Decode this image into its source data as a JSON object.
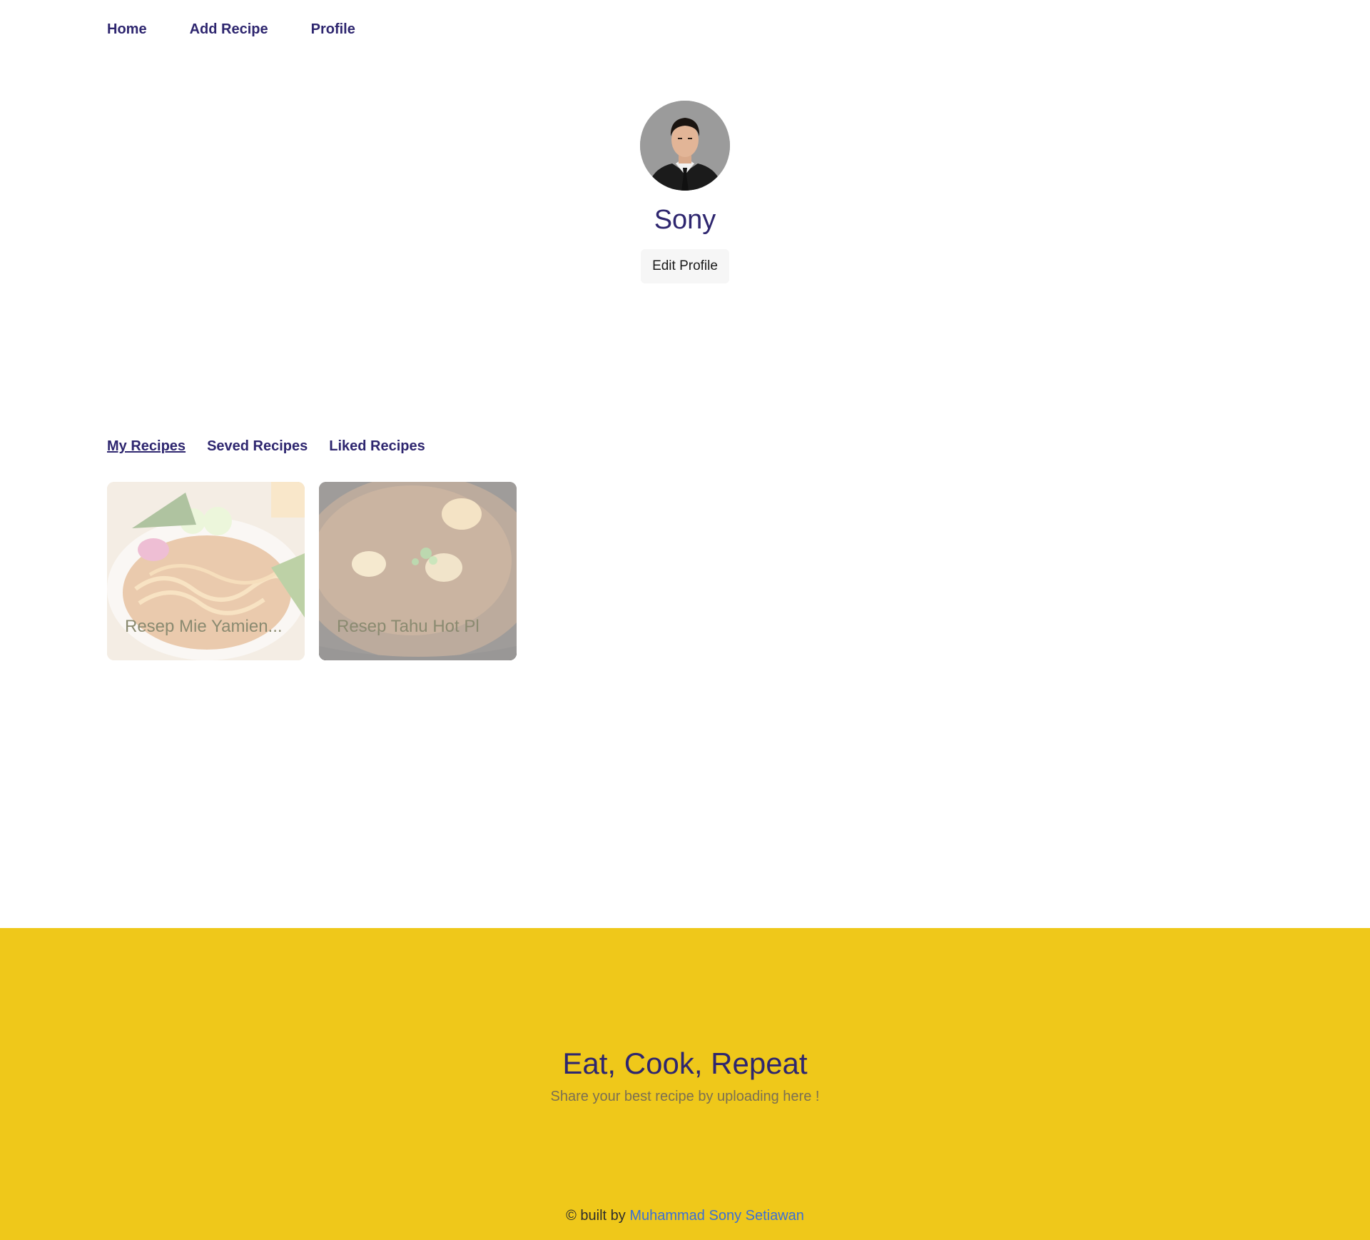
{
  "nav": {
    "items": [
      {
        "label": "Home"
      },
      {
        "label": "Add Recipe"
      },
      {
        "label": "Profile"
      }
    ]
  },
  "profile": {
    "name": "Sony",
    "edit_label": "Edit Profile"
  },
  "tabs": [
    {
      "label": "My Recipes",
      "active": true
    },
    {
      "label": "Seved Recipes",
      "active": false
    },
    {
      "label": "Liked Recipes",
      "active": false
    }
  ],
  "recipes": [
    {
      "title": "Resep Mie Yamien..."
    },
    {
      "title": "Resep Tahu Hot Pl"
    }
  ],
  "footer": {
    "title": "Eat, Cook, Repeat",
    "subtitle": "Share your best recipe by uploading here !",
    "credit_prefix": "© built by",
    "credit_name": "Muhammad Sony Setiawan"
  },
  "colors": {
    "primary": "#2e266f",
    "footer_bg": "#efc81a",
    "link": "#3a6fd6"
  },
  "icons": {
    "avatar": "user-photo"
  }
}
